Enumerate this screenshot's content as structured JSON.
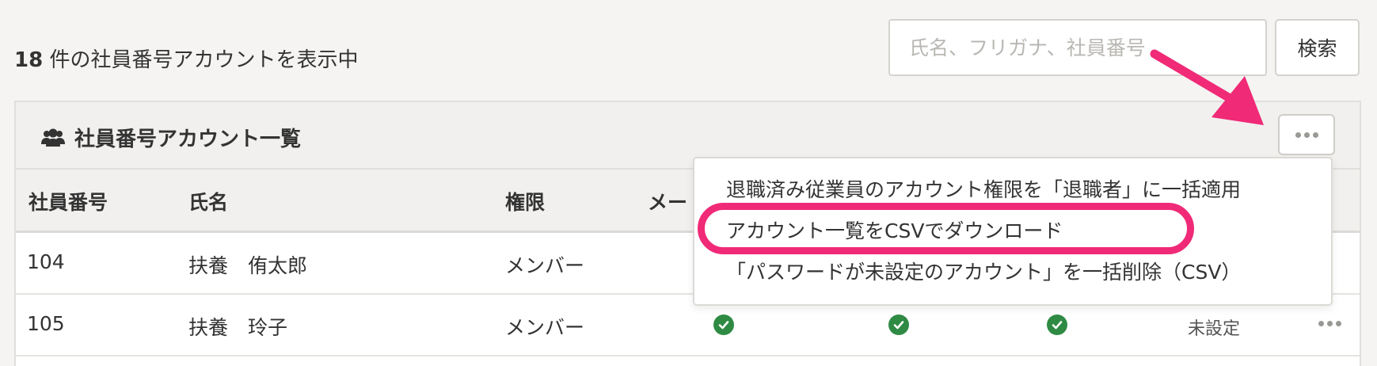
{
  "summary": {
    "count": "18",
    "suffix": " 件の社員番号アカウントを表示中"
  },
  "search": {
    "placeholder": "氏名、フリガナ、社員番号",
    "button_label": "検索"
  },
  "panel": {
    "icon": "users-icon",
    "title": "社員番号アカウント一覧"
  },
  "table": {
    "headers": [
      "社員番号",
      "氏名",
      "権限",
      "メー"
    ],
    "rows": [
      {
        "id": "104",
        "name": "扶養　侑太郎",
        "role": "メンバー"
      },
      {
        "id": "105",
        "name": "扶養　玲子",
        "role": "メンバー",
        "status": "未設定"
      }
    ]
  },
  "menu": {
    "items": [
      "退職済み従業員のアカウント権限を「退職者」に一括適用",
      "アカウント一覧をCSVでダウンロード",
      "「パスワードが未設定のアカウント」を一括削除（CSV）"
    ]
  },
  "colors": {
    "annotation": "#f02a77",
    "check": "#2f8a44"
  }
}
